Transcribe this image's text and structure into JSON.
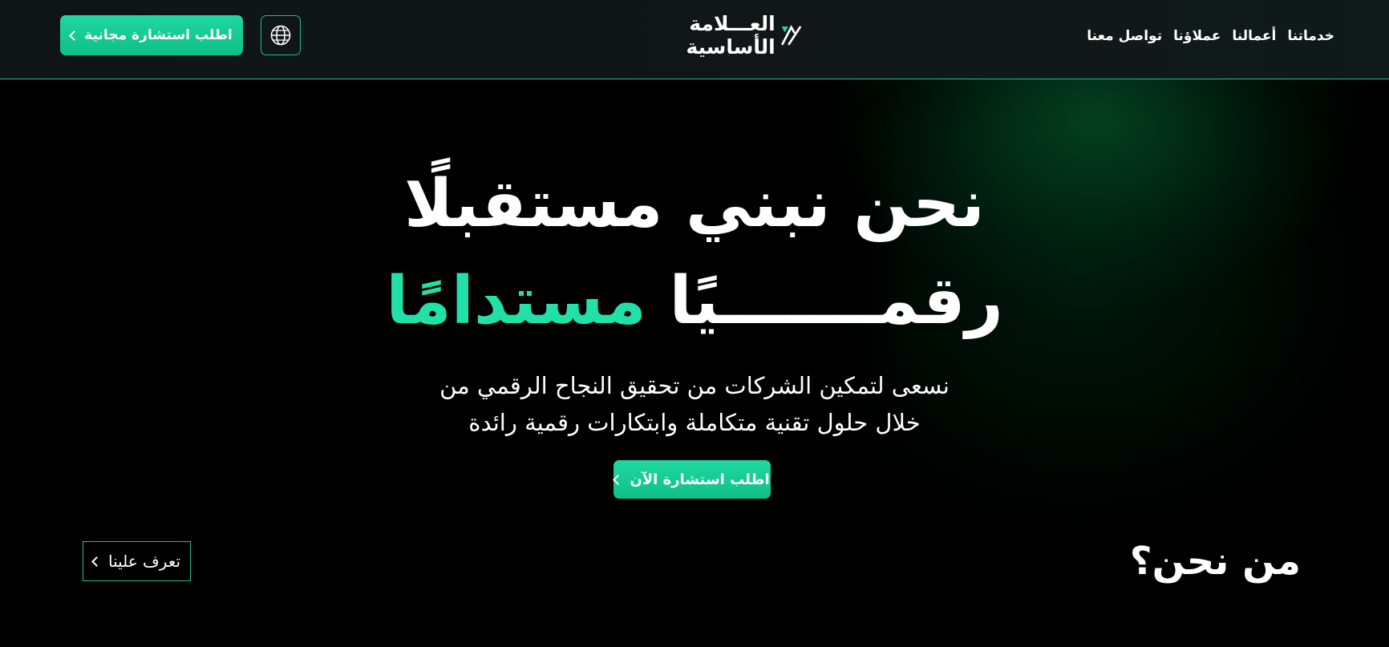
{
  "header": {
    "cta_label": "اطلب استشارة مجانية",
    "logo_text": "العـــلامة الأساسية",
    "nav": [
      "خدماتنا",
      "أعمالنا",
      "عملاؤنا",
      "تواصل معنا"
    ]
  },
  "hero": {
    "line1": "نحن نبني مستقبلًا",
    "line2_white": "رقمـــــــيًا",
    "line2_green": "مستدامًا",
    "subtitle_line1": "نسعى لتمكين الشركات من تحقيق النجاح الرقمي من",
    "subtitle_line2": "خلال حلول تقنية متكاملة وابتكارات رقمية رائدة",
    "cta_label": "اطلب استشارة الآن"
  },
  "about": {
    "title": "من نحن؟",
    "button_label": "تعرف علينا"
  },
  "icons": {
    "globe": "globe-icon",
    "chevron": "chevron-left-icon",
    "logo": "logo-mark-icon"
  },
  "colors": {
    "accent": "#1fd8a0",
    "accent_text": "#21e0a8",
    "header_bg": "#111719"
  }
}
